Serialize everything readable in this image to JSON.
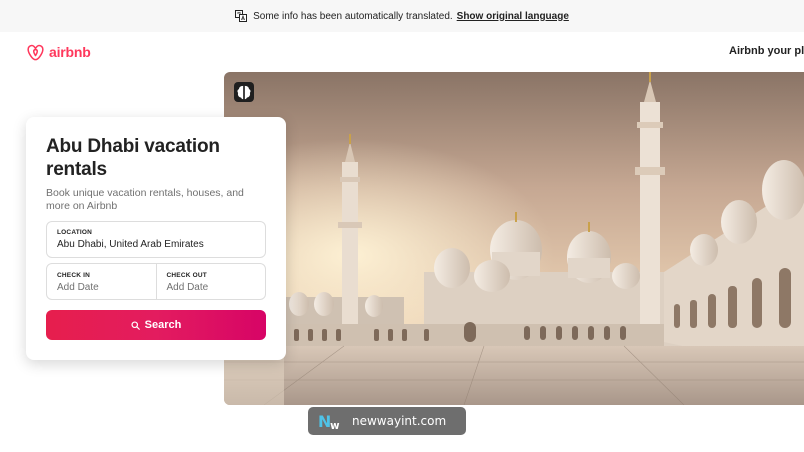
{
  "banner": {
    "message": "Some info has been automatically translated.",
    "link": "Show original language",
    "icon": "translate-icon"
  },
  "header": {
    "logo_text": "airbnb",
    "host_link": "Airbnb your plac",
    "brand_color": "#FF385C"
  },
  "search_card": {
    "title": "Abu Dhabi vacation rentals",
    "subtitle": "Book unique vacation rentals, houses, and more on Airbnb",
    "location_label": "LOCATION",
    "location_value": "Abu Dhabi, United Arab Emirates",
    "checkin_label": "CHECK IN",
    "checkin_placeholder": "Add Date",
    "checkout_label": "CHECK OUT",
    "checkout_placeholder": "Add Date",
    "search_label": "Search",
    "search_color": "#E31C5F"
  },
  "hero": {
    "badge_icon": "brain-icon"
  },
  "watermark": {
    "text": "newwayint.com"
  }
}
